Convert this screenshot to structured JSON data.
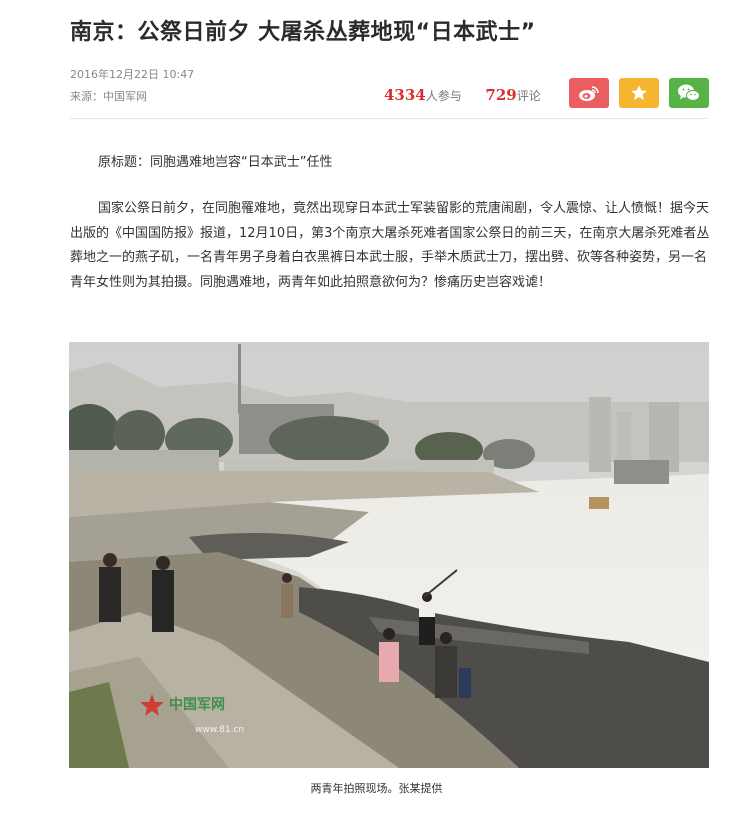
{
  "article": {
    "title": "南京：公祭日前夕 大屠杀丛葬地现“日本武士”",
    "date": "2016年12月22日  10:47",
    "source": "来源：中国军网",
    "participants_count": "4334",
    "participants_label": "人参与",
    "comments_count": "729",
    "comments_label": "评论",
    "original_title": "原标题：同胞遇难地岂容“日本武士”任性",
    "body": "国家公祭日前夕，在同胞罹难地，竟然出现穿日本武士军装留影的荒唐闹剧，令人震惊、让人愤慨！据今天出版的《中国国防报》报道，12月10日，第3个南京大屠杀死难者国家公祭日的前三天，在南京大屠杀死难者丛葬地之一的燕子矶，一名青年男子身着白衣黑裤日本武士服，手举木质武士刀，摆出劈、砍等各种姿势，另一名青年女性则为其拍摄。同胞遇难地，两青年如此拍照意欲何为？惨痛历史岂容戏谑！",
    "photo_watermark_name": "中国军网",
    "photo_watermark_url": "www.81.cn",
    "photo_caption": "两青年拍照现场。张某提供"
  },
  "share": {
    "weibo_icon": "weibo-icon",
    "favorite_icon": "star-icon",
    "wechat_icon": "wechat-icon",
    "weibo_color": "#ea5e62",
    "favorite_color": "#f6b52e",
    "wechat_color": "#57b346"
  },
  "colors": {
    "accent_number": "#d9302c",
    "meta_text": "#888888"
  }
}
